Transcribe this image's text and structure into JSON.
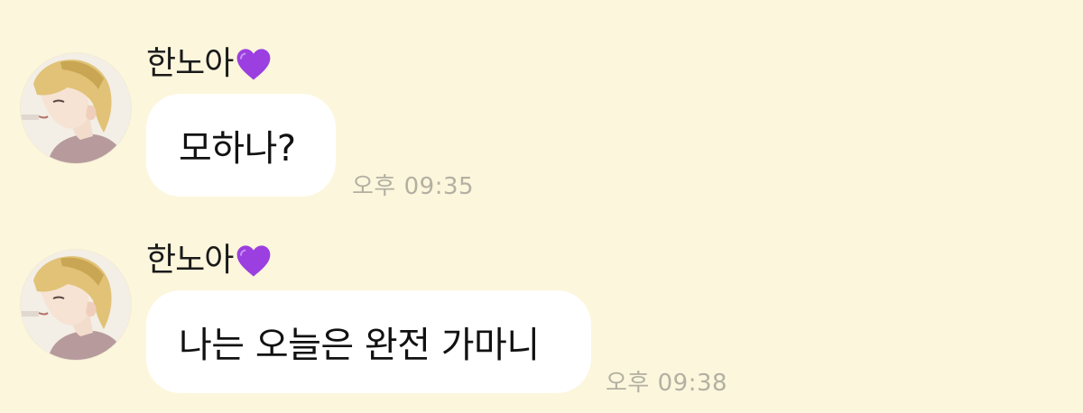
{
  "messages": [
    {
      "sender": "한노아",
      "sender_badge_icon": "purple-heart-icon",
      "text": "모하나?",
      "time": "오후 09:35"
    },
    {
      "sender": "한노아",
      "sender_badge_icon": "purple-heart-icon",
      "text": "나는 오늘은 완전 가마니",
      "time": "오후 09:38"
    }
  ],
  "colors": {
    "background": "#fcf6dc",
    "bubble": "#ffffff",
    "timestamp": "#b3b0a2",
    "heart": "#9b3fe0"
  }
}
